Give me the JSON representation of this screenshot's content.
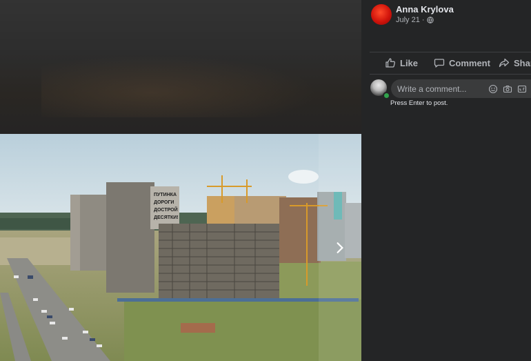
{
  "post": {
    "author": "Anna Krylova",
    "date": "July 21",
    "separator": "·",
    "privacy_icon": "globe-icon"
  },
  "actions": {
    "like": "Like",
    "comment": "Comment",
    "share": "Share"
  },
  "comment_box": {
    "placeholder": "Write a comment...",
    "hint": "Press Enter to post.",
    "icons": [
      "emoji-icon",
      "camera-icon",
      "gif-icon"
    ]
  },
  "photo": {
    "sign_lines": [
      "ПУТИНКА",
      "ДОРОГИ",
      "ДОСТРОЙ",
      "ДЕСЯТКИ!"
    ]
  },
  "colors": {
    "panel_bg": "#242526",
    "text_primary": "#e4e6eb",
    "text_secondary": "#b0b3b8",
    "input_bg": "#3a3b3c",
    "online": "#31a24c"
  }
}
